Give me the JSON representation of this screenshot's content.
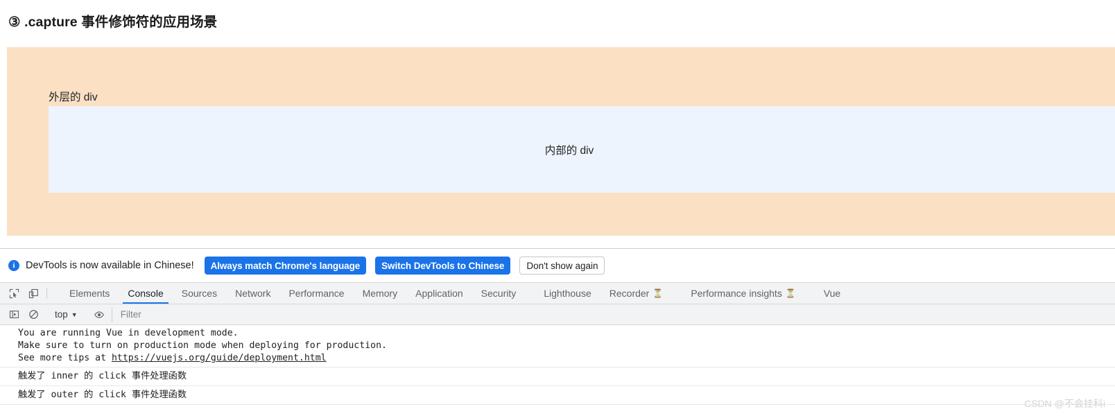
{
  "page": {
    "heading": "③ .capture 事件修饰符的应用场景",
    "outer_div_label": "外层的 div",
    "inner_div_label": "内部的 div",
    "outer_div_color": "#fbe0c3",
    "inner_div_color": "#edf4fd"
  },
  "devtools": {
    "notification": {
      "icon": "info-icon",
      "message": "DevTools is now available in Chinese!",
      "buttons": [
        {
          "label": "Always match Chrome's language",
          "style": "primary"
        },
        {
          "label": "Switch DevTools to Chinese",
          "style": "primary"
        },
        {
          "label": "Don't show again",
          "style": "secondary"
        }
      ]
    },
    "toolbar_icons": [
      {
        "name": "inspect-element-icon"
      },
      {
        "name": "device-toolbar-icon"
      }
    ],
    "tabs": [
      {
        "label": "Elements",
        "active": false,
        "badge": ""
      },
      {
        "label": "Console",
        "active": true,
        "badge": ""
      },
      {
        "label": "Sources",
        "active": false,
        "badge": ""
      },
      {
        "label": "Network",
        "active": false,
        "badge": ""
      },
      {
        "label": "Performance",
        "active": false,
        "badge": ""
      },
      {
        "label": "Memory",
        "active": false,
        "badge": ""
      },
      {
        "label": "Application",
        "active": false,
        "badge": ""
      },
      {
        "label": "Security",
        "active": false,
        "badge": ""
      },
      {
        "label": "Lighthouse",
        "active": false,
        "badge": ""
      },
      {
        "label": "Recorder",
        "active": false,
        "badge": "⏳"
      },
      {
        "label": "Performance insights",
        "active": false,
        "badge": "⏳"
      },
      {
        "label": "Vue",
        "active": false,
        "badge": ""
      }
    ],
    "console_toolbar": {
      "sidebar_toggle": "console-sidebar-icon",
      "clear_console": "clear-console-icon",
      "context_value": "top",
      "context_chevron": "▼",
      "live_expression": "eye-icon",
      "filter_placeholder": "Filter",
      "filter_value": ""
    },
    "console_messages": [
      {
        "type": "group",
        "lines": [
          {
            "text": "You are running Vue in development mode."
          },
          {
            "text": "Make sure to turn on production mode when deploying for production."
          },
          {
            "prefix": "See more tips at ",
            "link": "https://vuejs.org/guide/deployment.html"
          }
        ]
      },
      {
        "type": "row",
        "text": "触发了 inner 的 click 事件处理函数"
      },
      {
        "type": "row",
        "text": "触发了 outer 的 click 事件处理函数"
      }
    ],
    "accent_color": "#1a73e8"
  },
  "watermark": "CSDN @不会挂科i"
}
